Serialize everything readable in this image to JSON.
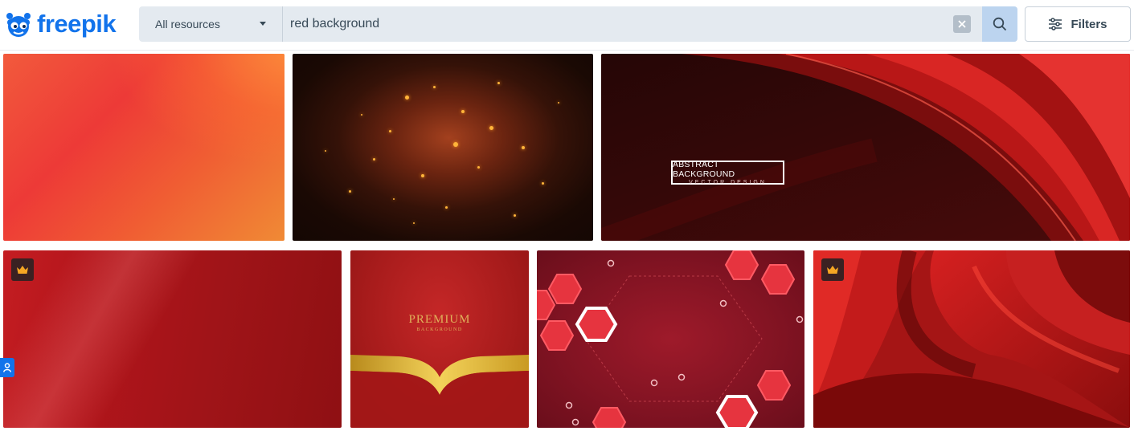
{
  "brand": {
    "name": "freepik",
    "color": "#1273eb"
  },
  "search": {
    "category": "All resources",
    "query": "red background",
    "clear_icon": "close-icon",
    "search_icon": "search-icon"
  },
  "filters": {
    "label": "Filters",
    "icon": "sliders-icon"
  },
  "results": [
    {
      "id": "gradient-red-orange",
      "premium": false
    },
    {
      "id": "glitter-particles",
      "premium": false
    },
    {
      "id": "abstract-red-wave",
      "premium": false,
      "text_line1": "ABSTRACT BACKGROUND",
      "text_line2": "VECTOR DESIGN"
    },
    {
      "id": "red-gradient-premium",
      "premium": true
    },
    {
      "id": "premium-gold-ribbon",
      "premium": false,
      "text_line1": "PREMIUM",
      "text_line2": "BACKGROUND"
    },
    {
      "id": "red-hexagon-tech",
      "premium": false
    },
    {
      "id": "red-silk-drapery",
      "premium": true
    }
  ],
  "side_tab": {
    "icon": "person-icon"
  }
}
